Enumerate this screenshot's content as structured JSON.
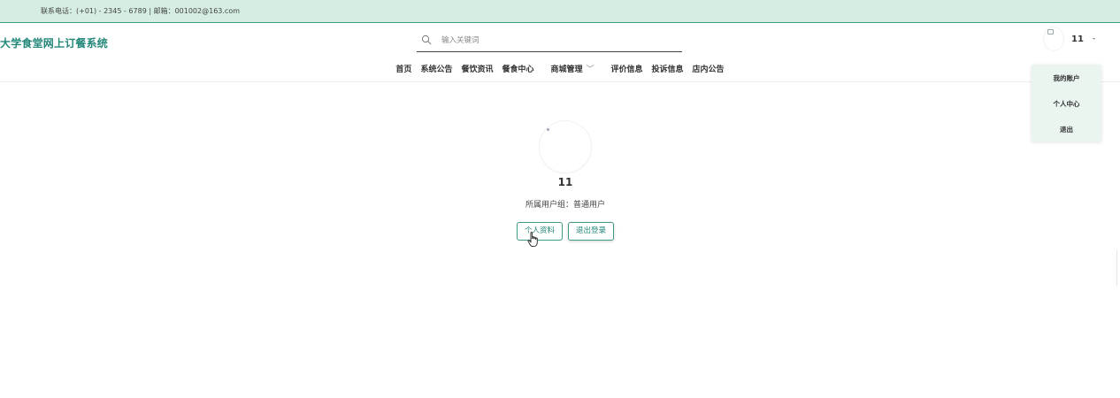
{
  "topbar": {
    "contact": "联系电话：(+01) - 2345 - 6789 | 邮箱：001002@163.com"
  },
  "header": {
    "brand": "大学食堂网上订餐系统",
    "search_placeholder": "输入关键词",
    "search_icon": "search-icon",
    "user_name": "11",
    "caret": "-"
  },
  "nav": {
    "items": [
      {
        "label": "首页"
      },
      {
        "label": "系统公告"
      },
      {
        "label": "餐饮资讯"
      },
      {
        "label": "餐食中心"
      },
      {
        "label": "商城管理",
        "chevron": "﹀"
      },
      {
        "label": "评价信息"
      },
      {
        "label": "投诉信息"
      },
      {
        "label": "店内公告"
      }
    ]
  },
  "dropdown": {
    "items": [
      {
        "label": "我的账户"
      },
      {
        "label": "个人中心"
      },
      {
        "label": "退出"
      }
    ]
  },
  "profile": {
    "name": "11",
    "group": "所属用户组：普通用户",
    "profile_button": "个人资料",
    "logout_button": "退出登录"
  },
  "colors": {
    "accent": "#23877a",
    "topbar_bg": "#d5ede2"
  }
}
